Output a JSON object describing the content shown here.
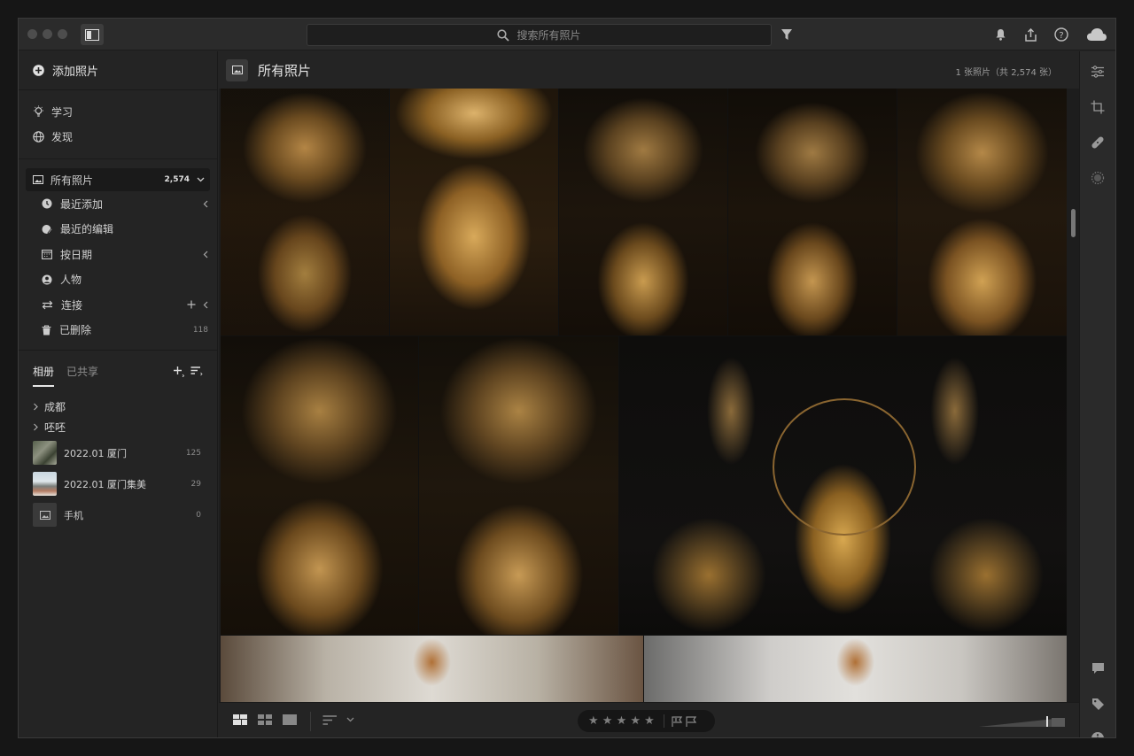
{
  "search": {
    "placeholder": "搜索所有照片"
  },
  "left_panel": {
    "add_photos": "添加照片",
    "top_items": [
      {
        "label": "学习",
        "icon": "lightbulb-icon"
      },
      {
        "label": "发现",
        "icon": "globe-icon"
      }
    ],
    "all_photos": {
      "label": "所有照片",
      "count": "2,574"
    },
    "sub_items": [
      {
        "label": "最近添加",
        "icon": "clock-icon"
      },
      {
        "label": "最近的编辑",
        "icon": "recent-edits-icon"
      },
      {
        "label": "按日期",
        "icon": "calendar-icon"
      },
      {
        "label": "人物",
        "icon": "person-icon"
      },
      {
        "label": "连接",
        "icon": "connection-icon"
      },
      {
        "label": "已删除",
        "icon": "trash-icon",
        "count": "118"
      }
    ],
    "tabs": {
      "albums": "相册",
      "shared": "已共享"
    },
    "folders": [
      {
        "label": "成都"
      },
      {
        "label": "呸呸"
      }
    ],
    "albums": [
      {
        "label": "2022.01 厦门",
        "count": "125"
      },
      {
        "label": "2022.01 厦门集美",
        "count": "29"
      },
      {
        "label": "手机",
        "count": "0"
      }
    ]
  },
  "main": {
    "title": "所有照片",
    "photo_count": "1 张照片（共 2,574 张）"
  },
  "bottom_bar": {
    "stars": "★ ★ ★ ★ ★",
    "view_modes": [
      "grid-view-icon",
      "square-grid-icon",
      "single-view-icon"
    ]
  },
  "right_toolbar": [
    "edit-sliders-icon",
    "crop-icon",
    "healing-icon",
    "masking-icon",
    "comment-icon",
    "tag-icon",
    "info-icon"
  ],
  "colors": {
    "accent": "#e6e6e6",
    "background": "#242424",
    "photo_gold": "#b98a3a"
  }
}
